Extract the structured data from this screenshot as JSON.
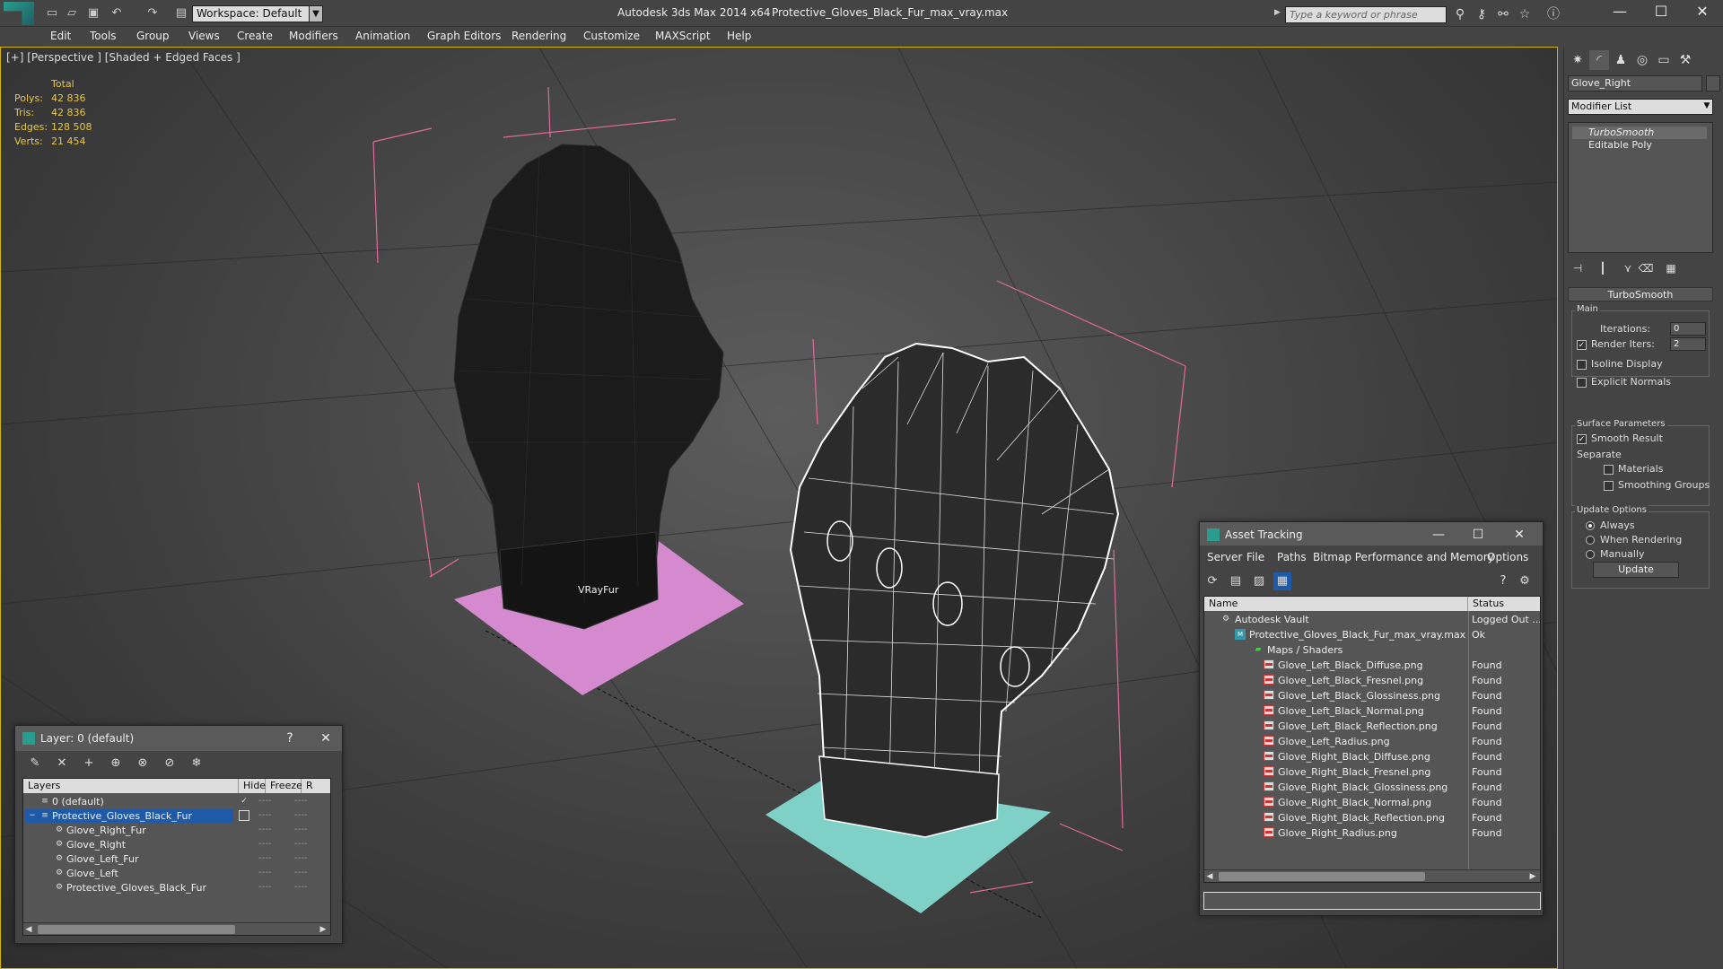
{
  "window": {
    "app_title": "Autodesk 3ds Max  2014 x64",
    "file_title": "Protective_Gloves_Black_Fur_max_vray.max",
    "workspace": "Workspace: Default",
    "search_placeholder": "Type a keyword or phrase"
  },
  "menu": [
    "Edit",
    "Tools",
    "Group",
    "Views",
    "Create",
    "Modifiers",
    "Animation",
    "Graph Editors",
    "Rendering",
    "Customize",
    "MAXScript",
    "Help"
  ],
  "viewport": {
    "label": "[+] [Perspective ] [Shaded + Edged Faces ]",
    "stats_header": "Total",
    "stats": [
      {
        "label": "Polys:",
        "value": "42 836"
      },
      {
        "label": "Tris:",
        "value": "42 836"
      },
      {
        "label": "Edges:",
        "value": "128 508"
      },
      {
        "label": "Verts:",
        "value": "21 454"
      }
    ],
    "fur_label": "VRayFur"
  },
  "command_panel": {
    "object_name": "Glove_Right",
    "modifier_list": "Modifier List",
    "stack": [
      "TurboSmooth",
      "Editable Poly"
    ],
    "rollout_title": "TurboSmooth",
    "main_group": "Main",
    "iterations_label": "Iterations:",
    "iterations_value": "0",
    "render_iters_label": "Render Iters:",
    "render_iters_value": "2",
    "isoline_label": "Isoline Display",
    "explicit_normals_label": "Explicit Normals",
    "surface_group": "Surface Parameters",
    "smooth_result_label": "Smooth Result",
    "separate_label": "Separate",
    "materials_label": "Materials",
    "smoothing_groups_label": "Smoothing Groups",
    "update_group": "Update Options",
    "always_label": "Always",
    "when_rendering_label": "When Rendering",
    "manually_label": "Manually",
    "update_button": "Update"
  },
  "layer_window": {
    "title": "Layer: 0 (default)",
    "help": "?",
    "columns": [
      "Layers",
      "Hide",
      "Freeze",
      "R"
    ],
    "rows": [
      {
        "name": "0 (default)",
        "level": 0
      },
      {
        "name": "Protective_Gloves_Black_Fur",
        "level": 0
      },
      {
        "name": "Glove_Right_Fur",
        "level": 1
      },
      {
        "name": "Glove_Right",
        "level": 1
      },
      {
        "name": "Glove_Left_Fur",
        "level": 1
      },
      {
        "name": "Glove_Left",
        "level": 1
      },
      {
        "name": "Protective_Gloves_Black_Fur",
        "level": 1
      }
    ],
    "dash": "----"
  },
  "asset_tracking": {
    "title": "Asset Tracking",
    "menu": [
      "Server",
      "File",
      "Paths",
      "Bitmap Performance and Memory",
      "Options"
    ],
    "columns": [
      "Name",
      "Status"
    ],
    "rows": [
      {
        "name": "Autodesk Vault",
        "status": "Logged Out ...",
        "level": 0,
        "icon": "vault"
      },
      {
        "name": "Protective_Gloves_Black_Fur_max_vray.max",
        "status": "Ok",
        "level": 1,
        "icon": "max"
      },
      {
        "name": "Maps / Shaders",
        "status": "",
        "level": 2,
        "icon": "maps"
      },
      {
        "name": "Glove_Left_Black_Diffuse.png",
        "status": "Found",
        "level": 3,
        "icon": "png"
      },
      {
        "name": "Glove_Left_Black_Fresnel.png",
        "status": "Found",
        "level": 3,
        "icon": "png"
      },
      {
        "name": "Glove_Left_Black_Glossiness.png",
        "status": "Found",
        "level": 3,
        "icon": "png"
      },
      {
        "name": "Glove_Left_Black_Normal.png",
        "status": "Found",
        "level": 3,
        "icon": "png"
      },
      {
        "name": "Glove_Left_Black_Reflection.png",
        "status": "Found",
        "level": 3,
        "icon": "png"
      },
      {
        "name": "Glove_Left_Radius.png",
        "status": "Found",
        "level": 3,
        "icon": "png"
      },
      {
        "name": "Glove_Right_Black_Diffuse.png",
        "status": "Found",
        "level": 3,
        "icon": "png"
      },
      {
        "name": "Glove_Right_Black_Fresnel.png",
        "status": "Found",
        "level": 3,
        "icon": "png"
      },
      {
        "name": "Glove_Right_Black_Glossiness.png",
        "status": "Found",
        "level": 3,
        "icon": "png"
      },
      {
        "name": "Glove_Right_Black_Normal.png",
        "status": "Found",
        "level": 3,
        "icon": "png"
      },
      {
        "name": "Glove_Right_Black_Reflection.png",
        "status": "Found",
        "level": 3,
        "icon": "png"
      },
      {
        "name": "Glove_Right_Radius.png",
        "status": "Found",
        "level": 3,
        "icon": "png"
      }
    ]
  },
  "colors": {
    "viewport_border": "#d4b400",
    "stats": "#e8c64a",
    "selection": "#1e5aa8",
    "bbox": "#e06a9a",
    "fur_pad_left": "#d58ad0",
    "fur_pad_right": "#7fd1c7"
  }
}
